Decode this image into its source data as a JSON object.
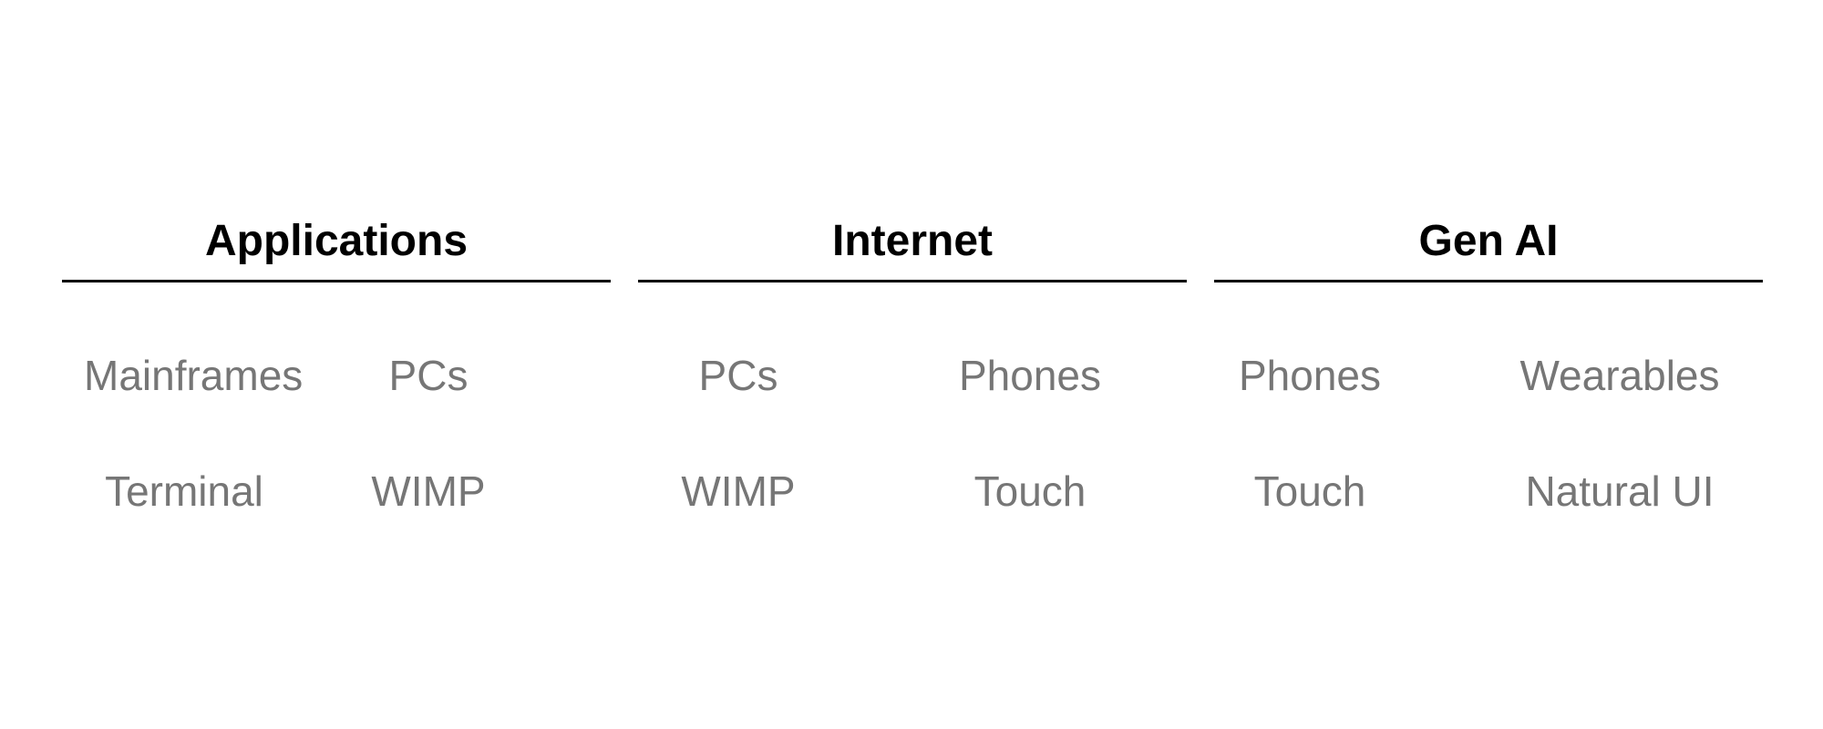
{
  "columns": [
    {
      "title": "Applications",
      "items": [
        [
          "Mainframes",
          "PCs"
        ],
        [
          "Terminal",
          "WIMP"
        ]
      ]
    },
    {
      "title": "Internet",
      "items": [
        [
          "PCs",
          "Phones"
        ],
        [
          "WIMP",
          "Touch"
        ]
      ]
    },
    {
      "title": "Gen AI",
      "items": [
        [
          "Phones",
          "Wearables"
        ],
        [
          "Touch",
          "Natural UI"
        ]
      ]
    }
  ]
}
